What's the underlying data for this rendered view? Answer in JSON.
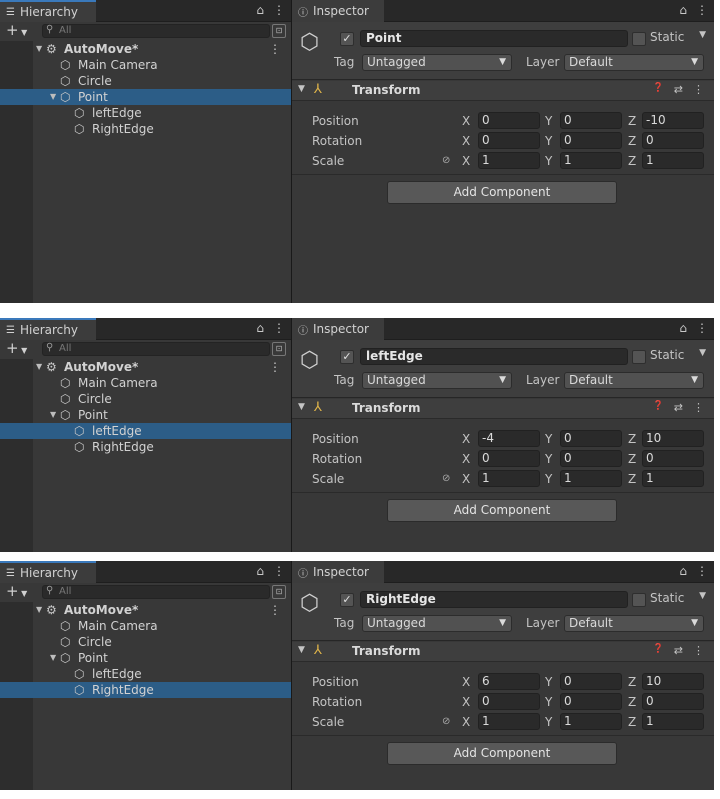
{
  "panels": [
    {
      "hierarchy": {
        "tab_label": "Hierarchy",
        "search_placeholder": "All",
        "items": [
          {
            "label": "AutoMove*",
            "depth": 0,
            "bold": true,
            "arrow": "▼",
            "icon": "unity-scene-icon",
            "selected": false,
            "kebab": true
          },
          {
            "label": "Main Camera",
            "depth": 1,
            "arrow": "",
            "icon": "cube-icon",
            "selected": false
          },
          {
            "label": "Circle",
            "depth": 1,
            "arrow": "",
            "icon": "cube-icon",
            "selected": false
          },
          {
            "label": "Point",
            "depth": 1,
            "arrow": "▼",
            "icon": "cube-icon",
            "selected": true
          },
          {
            "label": "leftEdge",
            "depth": 2,
            "arrow": "",
            "icon": "cube-icon",
            "selected": false
          },
          {
            "label": "RightEdge",
            "depth": 2,
            "arrow": "",
            "icon": "cube-icon",
            "selected": false
          }
        ]
      },
      "inspector": {
        "tab_label": "Inspector",
        "object_name": "Point",
        "static_label": "Static",
        "tag_label": "Tag",
        "tag_value": "Untagged",
        "layer_label": "Layer",
        "layer_value": "Default",
        "component_title": "Transform",
        "rows": [
          {
            "label": "Position",
            "x": "0",
            "y": "0",
            "z": "-10"
          },
          {
            "label": "Rotation",
            "x": "0",
            "y": "0",
            "z": "0"
          },
          {
            "label": "Scale",
            "x": "1",
            "y": "1",
            "z": "1"
          }
        ],
        "add_component": "Add Component"
      }
    },
    {
      "hierarchy": {
        "tab_label": "Hierarchy",
        "search_placeholder": "All",
        "items": [
          {
            "label": "AutoMove*",
            "depth": 0,
            "bold": true,
            "arrow": "▼",
            "icon": "unity-scene-icon",
            "selected": false,
            "kebab": true
          },
          {
            "label": "Main Camera",
            "depth": 1,
            "arrow": "",
            "icon": "cube-icon",
            "selected": false
          },
          {
            "label": "Circle",
            "depth": 1,
            "arrow": "",
            "icon": "cube-icon",
            "selected": false
          },
          {
            "label": "Point",
            "depth": 1,
            "arrow": "▼",
            "icon": "cube-icon",
            "selected": false
          },
          {
            "label": "leftEdge",
            "depth": 2,
            "arrow": "",
            "icon": "cube-icon",
            "selected": true
          },
          {
            "label": "RightEdge",
            "depth": 2,
            "arrow": "",
            "icon": "cube-icon",
            "selected": false
          }
        ]
      },
      "inspector": {
        "tab_label": "Inspector",
        "object_name": "leftEdge",
        "static_label": "Static",
        "tag_label": "Tag",
        "tag_value": "Untagged",
        "layer_label": "Layer",
        "layer_value": "Default",
        "component_title": "Transform",
        "rows": [
          {
            "label": "Position",
            "x": "-4",
            "y": "0",
            "z": "10"
          },
          {
            "label": "Rotation",
            "x": "0",
            "y": "0",
            "z": "0"
          },
          {
            "label": "Scale",
            "x": "1",
            "y": "1",
            "z": "1"
          }
        ],
        "add_component": "Add Component"
      }
    },
    {
      "hierarchy": {
        "tab_label": "Hierarchy",
        "search_placeholder": "All",
        "items": [
          {
            "label": "AutoMove*",
            "depth": 0,
            "bold": true,
            "arrow": "▼",
            "icon": "unity-scene-icon",
            "selected": false,
            "kebab": true
          },
          {
            "label": "Main Camera",
            "depth": 1,
            "arrow": "",
            "icon": "cube-icon",
            "selected": false
          },
          {
            "label": "Circle",
            "depth": 1,
            "arrow": "",
            "icon": "cube-icon",
            "selected": false
          },
          {
            "label": "Point",
            "depth": 1,
            "arrow": "▼",
            "icon": "cube-icon",
            "selected": false
          },
          {
            "label": "leftEdge",
            "depth": 2,
            "arrow": "",
            "icon": "cube-icon",
            "selected": false
          },
          {
            "label": "RightEdge",
            "depth": 2,
            "arrow": "",
            "icon": "cube-icon",
            "selected": true
          }
        ]
      },
      "inspector": {
        "tab_label": "Inspector",
        "object_name": "RightEdge",
        "static_label": "Static",
        "tag_label": "Tag",
        "tag_value": "Untagged",
        "layer_label": "Layer",
        "layer_value": "Default",
        "component_title": "Transform",
        "rows": [
          {
            "label": "Position",
            "x": "6",
            "y": "0",
            "z": "10"
          },
          {
            "label": "Rotation",
            "x": "0",
            "y": "0",
            "z": "0"
          },
          {
            "label": "Scale",
            "x": "1",
            "y": "1",
            "z": "1"
          }
        ],
        "add_component": "Add Component"
      }
    }
  ],
  "icons": {
    "hierarchy_tab": "list-icon",
    "inspector_tab": "info-icon",
    "lock": "lock-icon",
    "kebab": "kebab-menu-icon",
    "transform": "transform-axes-icon",
    "help": "help-icon",
    "presets": "presets-icon",
    "constrain": "constrain-proportions-icon"
  },
  "colors": {
    "panel_bg": "#383838",
    "selection": "#2c5d87",
    "tab_accent": "#3a79bb",
    "field_bg": "#2a2a2a"
  }
}
